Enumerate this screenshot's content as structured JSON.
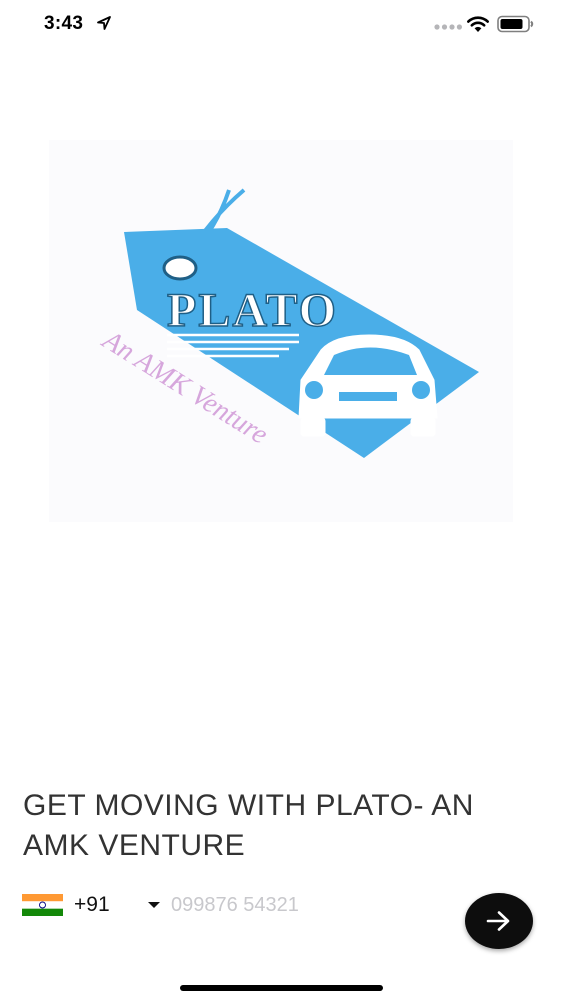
{
  "status_bar": {
    "time": "3:43"
  },
  "logo": {
    "brand_text": "PLATO",
    "tagline": "An AMK Venture",
    "brand_color": "#4aaee8",
    "tagline_color": "#d6a6dc"
  },
  "headline": "GET MOVING WITH PLATO- AN AMK VENTURE",
  "phone": {
    "country_flag": "india-flag",
    "dial_code": "+91",
    "placeholder": "099876 54321",
    "value": ""
  },
  "next_button": {
    "icon": "arrow-right-icon"
  }
}
